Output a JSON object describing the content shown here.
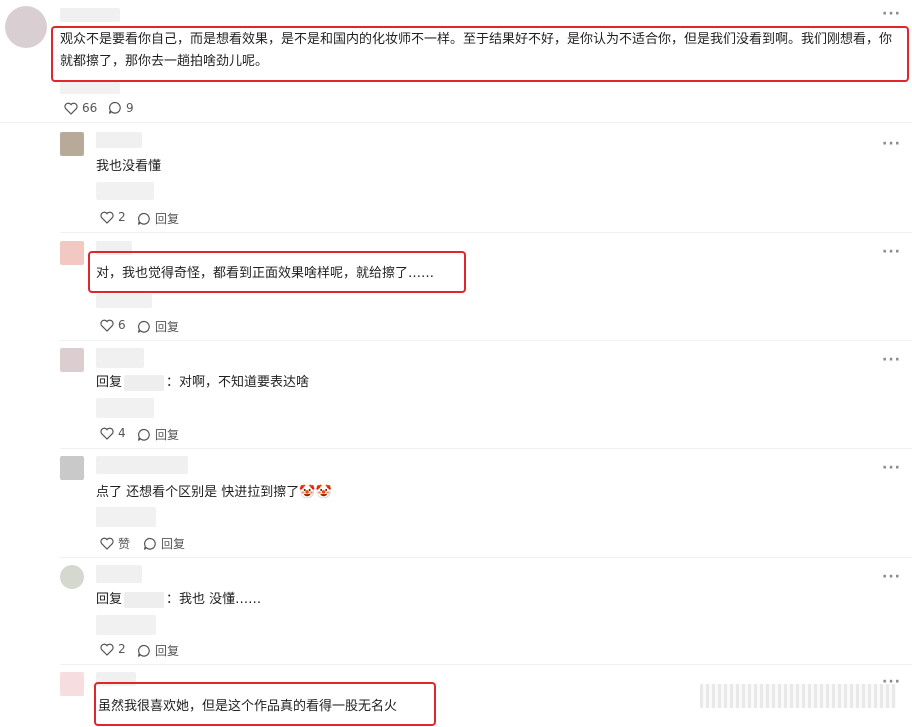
{
  "comments": [
    {
      "id": "c1",
      "text": "观众不是要看你自己，而是想看效果，是不是和国内的化妆师不一样。至于结果好不好，是你认为不适合你，但是我们没看到啊。我们刚想看，你就都擦了，那你去一趟拍啥劲儿呢。",
      "likes": "66",
      "replies": "9"
    },
    {
      "id": "c2",
      "text": "我也没看懂",
      "likes": "2",
      "reply_label": "回复"
    },
    {
      "id": "c3",
      "text": "对，我也觉得奇怪，都看到正面效果啥样呢，就给擦了……",
      "likes": "6",
      "reply_label": "回复"
    },
    {
      "id": "c4",
      "prefix": "回复",
      "text": "：对啊，不知道要表达啥",
      "likes": "4",
      "reply_label": "回复"
    },
    {
      "id": "c5",
      "text": "点了 还想看个区别是 快进拉到擦了",
      "emoji": "🤡🤡",
      "likes": "赞",
      "reply_label": "回复"
    },
    {
      "id": "c6",
      "prefix": "回复",
      "text": "：我也 没懂……",
      "likes": "2",
      "reply_label": "回复"
    },
    {
      "id": "c7",
      "text": "虽然我很喜欢她，但是这个作品真的看得一股无名火"
    }
  ],
  "more_label": "···",
  "colors": {
    "highlight": "#e0262b"
  },
  "icons": {
    "like": "heart-outline-icon",
    "reply": "comment-bubble-icon",
    "more": "more-dots-icon"
  }
}
